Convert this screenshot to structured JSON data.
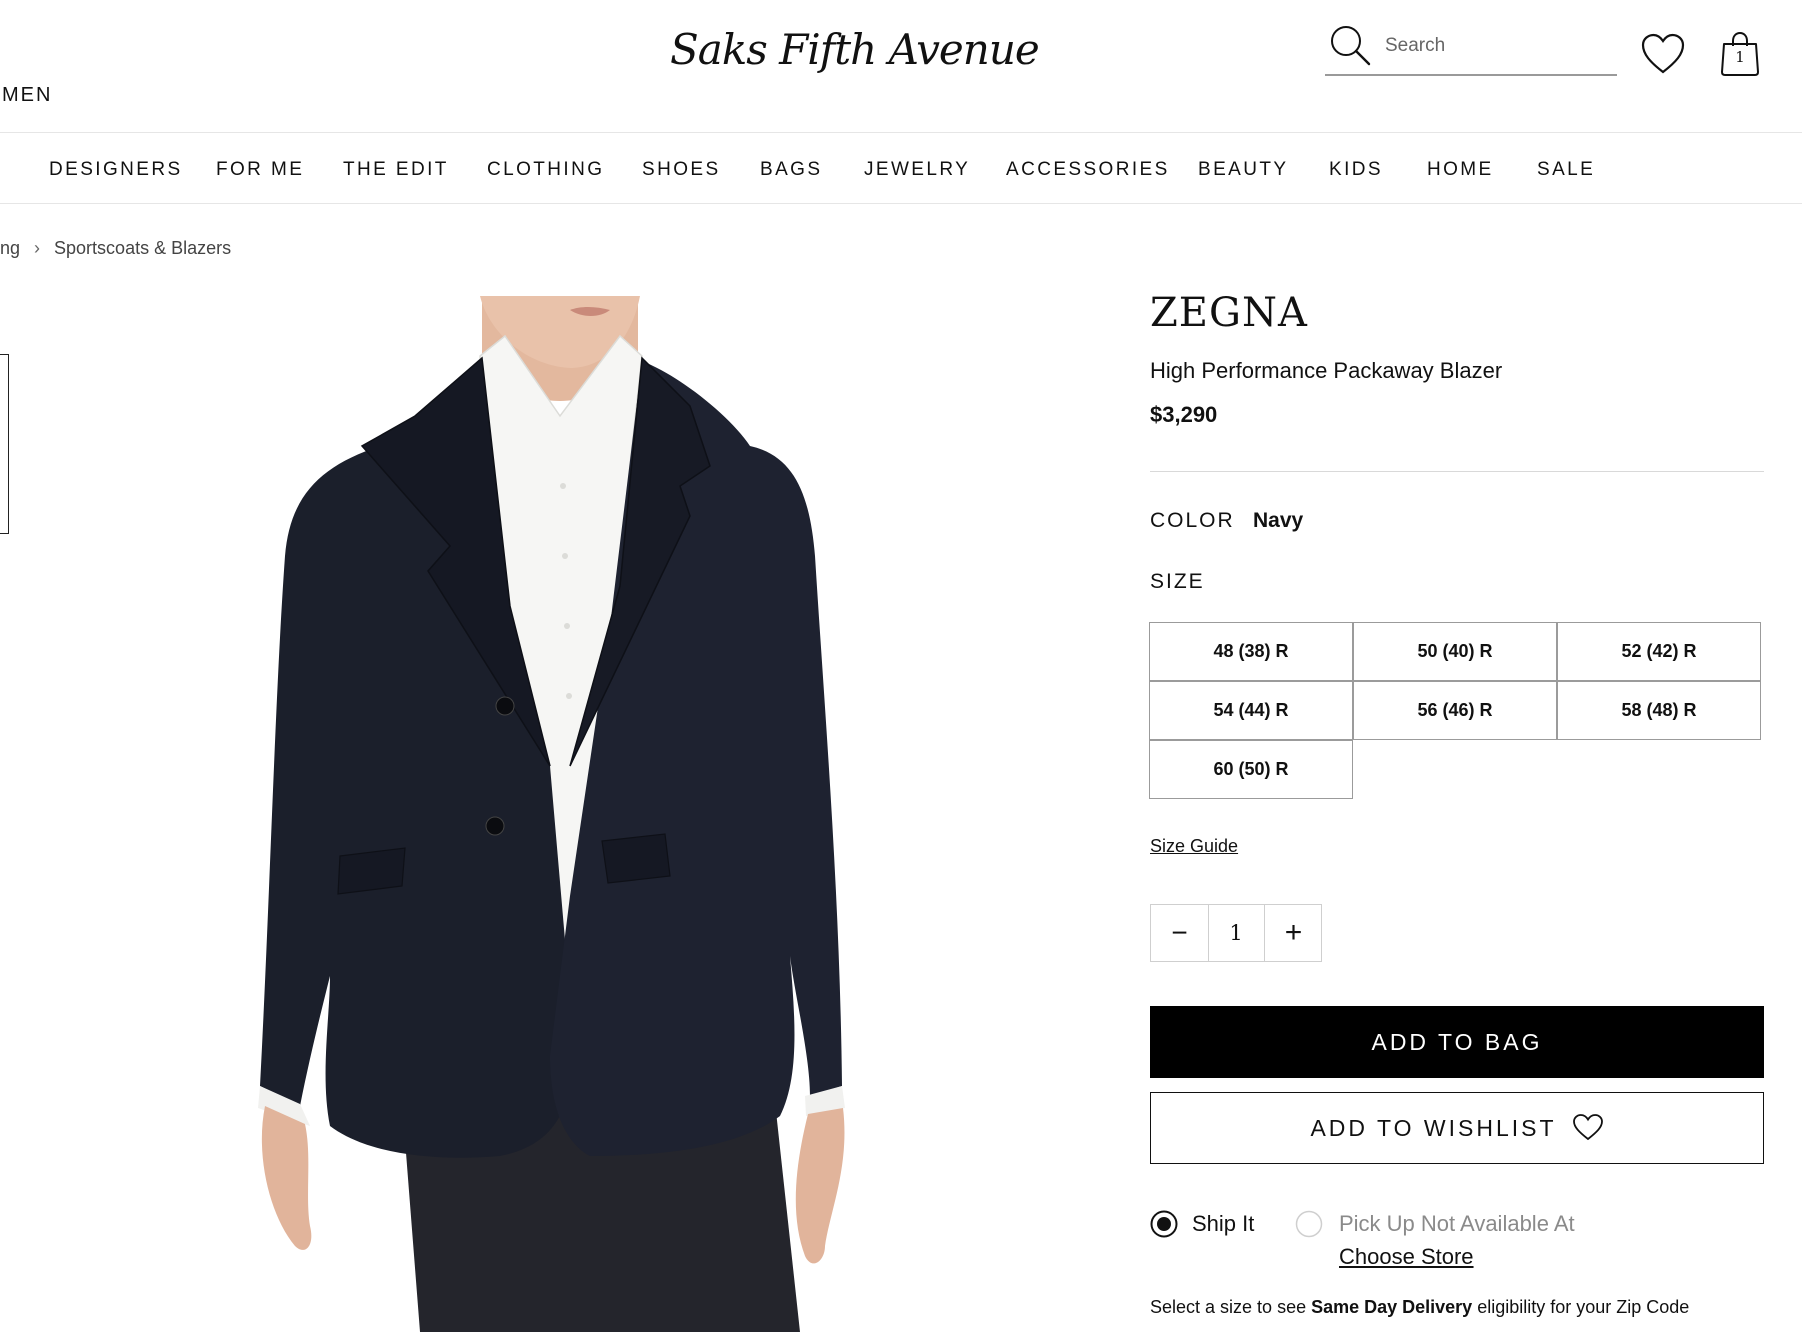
{
  "header": {
    "section_label": "MEN",
    "logo_text": "Saks Fifth Avenue",
    "search_placeholder": "Search",
    "bag_count": "1"
  },
  "nav": {
    "items": [
      "DESIGNERS",
      "FOR ME",
      "THE EDIT",
      "CLOTHING",
      "SHOES",
      "BAGS",
      "JEWELRY",
      "ACCESSORIES",
      "BEAUTY",
      "KIDS",
      "HOME",
      "SALE"
    ]
  },
  "breadcrumb": {
    "partial": "ng",
    "separator": "›",
    "current": "Sportscoats & Blazers"
  },
  "product": {
    "brand": "ZEGNA",
    "name": "High Performance Packaway Blazer",
    "price": "$3,290",
    "color_label": "COLOR",
    "color_value": "Navy",
    "size_label": "SIZE",
    "sizes": [
      "48 (38) R",
      "50 (40) R",
      "52 (42) R",
      "54 (44) R",
      "56 (46) R",
      "58 (48) R",
      "60 (50) R"
    ],
    "size_guide": "Size Guide",
    "quantity": "1",
    "qty_minus": "−",
    "qty_plus": "+",
    "add_to_bag": "ADD TO BAG",
    "add_to_wishlist": "ADD TO WISHLIST"
  },
  "fulfillment": {
    "ship_label": "Ship It",
    "ship_selected": true,
    "pickup_label": "Pick Up Not Available At",
    "choose_store": "Choose Store",
    "delivery_prefix": "Select a size to see ",
    "delivery_bold": "Same Day Delivery",
    "delivery_suffix": " eligibility for your Zip Code"
  },
  "colors": {
    "primary": "#000000",
    "muted": "#8a8a8a",
    "border": "#9b9b9b",
    "jacket": "#1b1f2b",
    "shirt": "#f5f5f3",
    "skin": "#e0b49a"
  }
}
